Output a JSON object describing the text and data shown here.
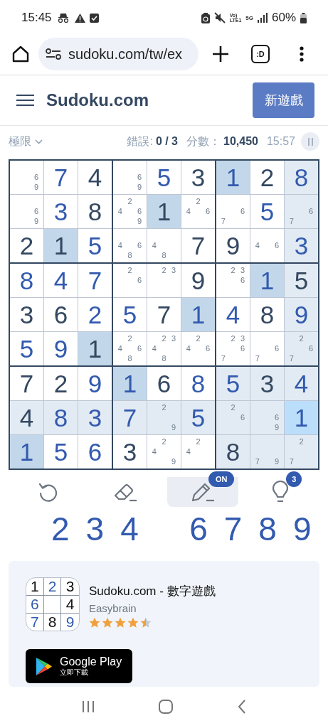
{
  "status_bar": {
    "time": "15:45",
    "volte_top": "Vo)",
    "volte_bottom": "LTE1",
    "network": "5G",
    "battery": "60%"
  },
  "browser": {
    "url": "sudoku.com/tw/ex",
    "tab_label": ":D"
  },
  "header": {
    "logo": "Sudoku.com",
    "new_game_button": "新遊戲"
  },
  "game_info": {
    "difficulty": "極限",
    "mistakes_label": "錯誤:",
    "mistakes": "0 / 3",
    "score_label": "分數：",
    "score": "10,450",
    "timer": "15:57"
  },
  "board": {
    "rows": [
      [
        {
          "kind": "notes",
          "notes": [
            "6",
            "9"
          ]
        },
        {
          "kind": "user",
          "value": "7"
        },
        {
          "kind": "given",
          "value": "4"
        },
        {
          "kind": "notes",
          "notes": [
            "6",
            "9"
          ]
        },
        {
          "kind": "user",
          "value": "5"
        },
        {
          "kind": "given",
          "value": "3"
        },
        {
          "kind": "user",
          "value": "1",
          "color": "#c3d7ea"
        },
        {
          "kind": "given",
          "value": "2"
        },
        {
          "kind": "user",
          "value": "8",
          "color": "#e2ebf3"
        }
      ],
      [
        {
          "kind": "notes",
          "notes": [
            "6",
            "9"
          ]
        },
        {
          "kind": "user",
          "value": "3"
        },
        {
          "kind": "given",
          "value": "8"
        },
        {
          "kind": "notes",
          "notes": [
            "2",
            "4",
            "6",
            "9"
          ]
        },
        {
          "kind": "given",
          "value": "1",
          "color": "#c3d7ea"
        },
        {
          "kind": "notes",
          "notes": [
            "2",
            "4",
            "6"
          ]
        },
        {
          "kind": "notes",
          "notes": [
            "6",
            "7"
          ]
        },
        {
          "kind": "user",
          "value": "5"
        },
        {
          "kind": "notes",
          "notes": [
            "6",
            "7"
          ],
          "color": "#e2ebf3"
        }
      ],
      [
        {
          "kind": "given",
          "value": "2"
        },
        {
          "kind": "given",
          "value": "1",
          "color": "#c3d7ea"
        },
        {
          "kind": "user",
          "value": "5"
        },
        {
          "kind": "notes",
          "notes": [
            "4",
            "6",
            "8"
          ]
        },
        {
          "kind": "notes",
          "notes": [
            "4",
            "8"
          ]
        },
        {
          "kind": "given",
          "value": "7"
        },
        {
          "kind": "given",
          "value": "9"
        },
        {
          "kind": "notes",
          "notes": [
            "4",
            "6"
          ]
        },
        {
          "kind": "user",
          "value": "3",
          "color": "#e2ebf3"
        }
      ],
      [
        {
          "kind": "user",
          "value": "8"
        },
        {
          "kind": "user",
          "value": "4"
        },
        {
          "kind": "user",
          "value": "7"
        },
        {
          "kind": "notes",
          "notes": [
            "2",
            "6"
          ]
        },
        {
          "kind": "notes",
          "notes": [
            "2",
            "3"
          ]
        },
        {
          "kind": "given",
          "value": "9"
        },
        {
          "kind": "notes",
          "notes": [
            "2",
            "3",
            "6"
          ]
        },
        {
          "kind": "user",
          "value": "1",
          "color": "#c3d7ea"
        },
        {
          "kind": "given",
          "value": "5",
          "color": "#e2ebf3"
        }
      ],
      [
        {
          "kind": "given",
          "value": "3"
        },
        {
          "kind": "given",
          "value": "6"
        },
        {
          "kind": "user",
          "value": "2"
        },
        {
          "kind": "user",
          "value": "5"
        },
        {
          "kind": "given",
          "value": "7"
        },
        {
          "kind": "user",
          "value": "1",
          "color": "#c3d7ea"
        },
        {
          "kind": "user",
          "value": "4"
        },
        {
          "kind": "given",
          "value": "8"
        },
        {
          "kind": "user",
          "value": "9",
          "color": "#e2ebf3"
        }
      ],
      [
        {
          "kind": "user",
          "value": "5"
        },
        {
          "kind": "user",
          "value": "9"
        },
        {
          "kind": "given",
          "value": "1",
          "color": "#c3d7ea"
        },
        {
          "kind": "notes",
          "notes": [
            "2",
            "4",
            "6",
            "8"
          ]
        },
        {
          "kind": "notes",
          "notes": [
            "2",
            "3",
            "4",
            "8"
          ]
        },
        {
          "kind": "notes",
          "notes": [
            "2",
            "4",
            "6"
          ]
        },
        {
          "kind": "notes",
          "notes": [
            "2",
            "3",
            "6",
            "7"
          ]
        },
        {
          "kind": "notes",
          "notes": [
            "6",
            "7"
          ]
        },
        {
          "kind": "notes",
          "notes": [
            "2",
            "6",
            "7"
          ],
          "color": "#e2ebf3"
        }
      ],
      [
        {
          "kind": "given",
          "value": "7"
        },
        {
          "kind": "given",
          "value": "2"
        },
        {
          "kind": "user",
          "value": "9"
        },
        {
          "kind": "user",
          "value": "1",
          "color": "#c3d7ea"
        },
        {
          "kind": "given",
          "value": "6"
        },
        {
          "kind": "user",
          "value": "8"
        },
        {
          "kind": "user",
          "value": "5",
          "color": "#e2ebf3"
        },
        {
          "kind": "given",
          "value": "3",
          "color": "#e2ebf3"
        },
        {
          "kind": "user",
          "value": "4",
          "color": "#e2ebf3"
        }
      ],
      [
        {
          "kind": "given",
          "value": "4",
          "color": "#e2ebf3"
        },
        {
          "kind": "user",
          "value": "8",
          "color": "#e2ebf3"
        },
        {
          "kind": "user",
          "value": "3",
          "color": "#e2ebf3"
        },
        {
          "kind": "user",
          "value": "7",
          "color": "#e2ebf3"
        },
        {
          "kind": "notes",
          "notes": [
            "2",
            "9"
          ],
          "color": "#e2ebf3"
        },
        {
          "kind": "user",
          "value": "5",
          "color": "#e2ebf3"
        },
        {
          "kind": "notes",
          "notes": [
            "2",
            "6"
          ],
          "color": "#e2ebf3"
        },
        {
          "kind": "notes",
          "notes": [
            "6",
            "9"
          ],
          "color": "#e2ebf3"
        },
        {
          "kind": "user",
          "value": "1",
          "color": "#bbdefb"
        }
      ],
      [
        {
          "kind": "user",
          "value": "1",
          "color": "#c3d7ea"
        },
        {
          "kind": "user",
          "value": "5"
        },
        {
          "kind": "user",
          "value": "6"
        },
        {
          "kind": "given",
          "value": "3"
        },
        {
          "kind": "notes",
          "notes": [
            "2",
            "4",
            "9"
          ]
        },
        {
          "kind": "notes",
          "notes": [
            "2",
            "4"
          ]
        },
        {
          "kind": "given",
          "value": "8",
          "color": "#e2ebf3"
        },
        {
          "kind": "notes",
          "notes": [
            "7",
            "9"
          ],
          "color": "#e2ebf3"
        },
        {
          "kind": "notes",
          "notes": [
            "2",
            "7"
          ],
          "color": "#e2ebf3"
        }
      ]
    ]
  },
  "toolbar": [
    {
      "kind": "undo",
      "selected": false
    },
    {
      "kind": "erase",
      "selected": false
    },
    {
      "kind": "notes",
      "selected": true,
      "badge": "ON"
    },
    {
      "kind": "hint",
      "selected": false,
      "badge": "3"
    }
  ],
  "number_pad": [
    {
      "kind": "empty"
    },
    {
      "kind": "digit",
      "label": "2"
    },
    {
      "kind": "digit",
      "label": "3"
    },
    {
      "kind": "digit",
      "label": "4"
    },
    {
      "kind": "empty"
    },
    {
      "kind": "digit",
      "label": "6"
    },
    {
      "kind": "digit",
      "label": "7"
    },
    {
      "kind": "digit",
      "label": "8"
    },
    {
      "kind": "digit",
      "label": "9"
    }
  ],
  "app_card": {
    "icon_cells": [
      {
        "kind": "given",
        "label": "1"
      },
      {
        "kind": "user",
        "label": "2"
      },
      {
        "kind": "given",
        "label": "3"
      },
      {
        "kind": "user",
        "label": "6"
      },
      {
        "kind": "empty"
      },
      {
        "kind": "given",
        "label": "4"
      },
      {
        "kind": "user",
        "label": "7"
      },
      {
        "kind": "given",
        "label": "8"
      },
      {
        "kind": "user",
        "label": "9"
      }
    ],
    "title": "Sudoku.com - 數字遊戲",
    "developer": "Easybrain",
    "stars": 4.5,
    "store_badge": {
      "name": "Google Play",
      "action": "立即下載"
    }
  }
}
